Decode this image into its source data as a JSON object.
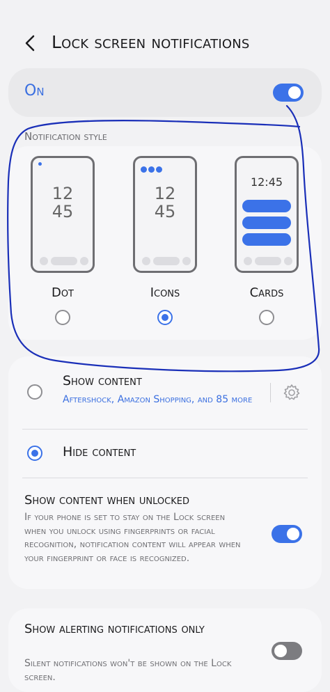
{
  "header": {
    "title": "Lock screen notifications"
  },
  "master": {
    "label": "On",
    "toggle_on": true
  },
  "notification_style": {
    "label": "Notification style",
    "options": [
      {
        "label": "Dot",
        "selected": false
      },
      {
        "label": "Icons",
        "selected": true,
        "clock_hours": "12",
        "clock_minutes": "45"
      },
      {
        "label": "Cards",
        "selected": false,
        "clock_time": "12:45"
      }
    ],
    "dot_preview": {
      "clock_hours": "12",
      "clock_minutes": "45"
    }
  },
  "content": {
    "show_content": {
      "label": "Show content",
      "apps": "Aftershock, Amazon Shopping, and 85 more",
      "selected": false
    },
    "hide_content": {
      "label": "Hide content",
      "selected": true
    },
    "unlocked": {
      "label": "Show content when unlocked",
      "description": "If your phone is set to stay on the Lock screen when you unlock using fingerprints or facial recognition, notification content will appear when your fingerprint or face is recognized.",
      "toggle_on": true
    }
  },
  "alerting": {
    "label": "Show alerting notifications only",
    "description": "Silent notifications won't be shown on the Lock screen.",
    "toggle_on": false
  },
  "colors": {
    "accent": "#3b72e8",
    "annotation": "#1a2fb8"
  }
}
